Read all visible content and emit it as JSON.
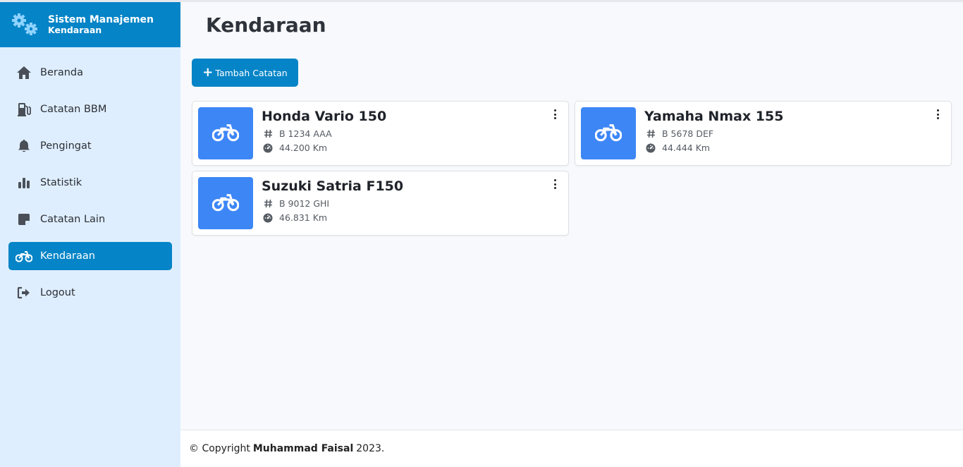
{
  "brand": {
    "title": "Sistem Manajemen",
    "subtitle": "Kendaraan",
    "icon": "gears-icon"
  },
  "sidebar": {
    "items": [
      {
        "label": "Beranda",
        "icon": "home-icon",
        "active": false
      },
      {
        "label": "Catatan BBM",
        "icon": "fuel-pump-icon",
        "active": false
      },
      {
        "label": "Pengingat",
        "icon": "bell-icon",
        "active": false
      },
      {
        "label": "Statistik",
        "icon": "bar-chart-icon",
        "active": false
      },
      {
        "label": "Catatan Lain",
        "icon": "sticky-note-icon",
        "active": false
      },
      {
        "label": "Kendaraan",
        "icon": "motorcycle-icon",
        "active": true
      },
      {
        "label": "Logout",
        "icon": "logout-icon",
        "active": false
      }
    ]
  },
  "main": {
    "title": "Kendaraan",
    "add_button": {
      "plus": "+",
      "label": "Tambah Catatan"
    },
    "vehicles": [
      {
        "name": "Honda Vario 150",
        "plate": "B 1234 AAA",
        "odometer": "44.200 Km"
      },
      {
        "name": "Yamaha Nmax 155",
        "plate": "B 5678 DEF",
        "odometer": "44.444 Km"
      },
      {
        "name": "Suzuki Satria F150",
        "plate": "B 9012 GHI",
        "odometer": "46.831 Km"
      }
    ]
  },
  "footer": {
    "prefix": "© Copyright",
    "author": "Muhammad Faisal",
    "suffix": "2023."
  },
  "colors": {
    "primary": "#0584c7",
    "sidebar_bg": "#dfeefe",
    "card_thumb": "#3d86f6"
  }
}
